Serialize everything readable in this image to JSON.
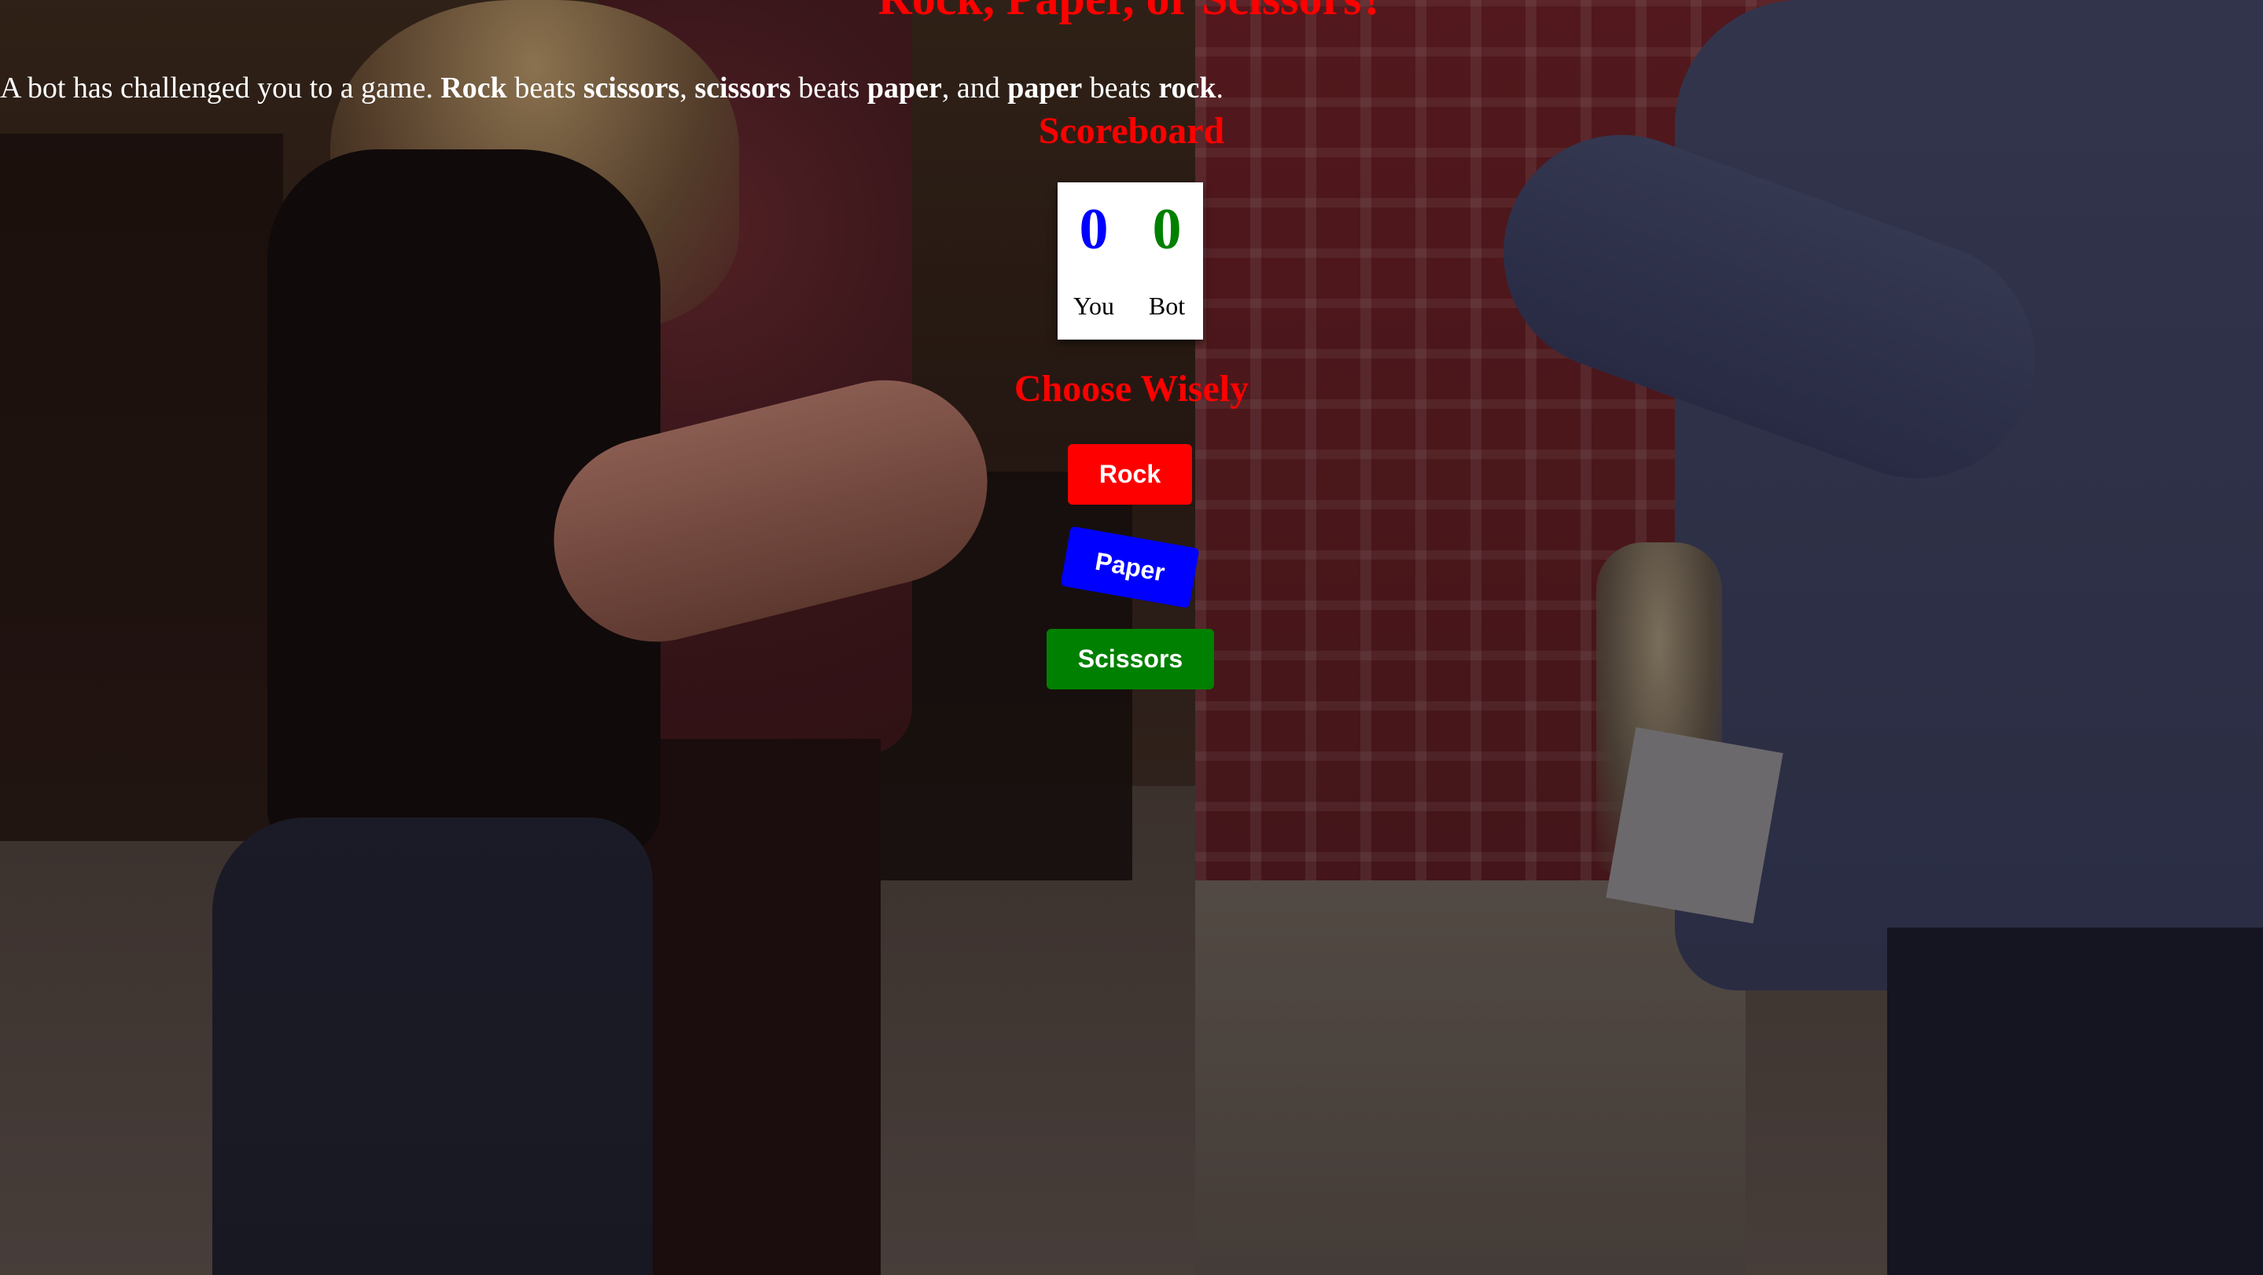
{
  "header": {
    "title": "Rock, Paper, or Scissors?"
  },
  "intro": {
    "p1": "A bot has challenged you to a game. ",
    "rock": "Rock",
    "p2": " beats ",
    "scissors": "scissors",
    "p3": ", ",
    "scissors2": "scissors",
    "p4": " beats ",
    "paper": "paper",
    "p5": ", and ",
    "paper2": "paper",
    "p6": " beats ",
    "rock2": "rock",
    "p7": "."
  },
  "scoreboard": {
    "title": "Scoreboard",
    "you_score": "0",
    "bot_score": "0",
    "you_label": "You",
    "bot_label": "Bot"
  },
  "choices": {
    "title": "Choose Wisely",
    "rock_label": "Rock",
    "paper_label": "Paper",
    "scissors_label": "Scissors"
  },
  "colors": {
    "heading": "#ff0000",
    "you_score": "#0000ff",
    "bot_score": "#008000",
    "rock_button": "#ff0000",
    "paper_button": "#0000ff",
    "scissors_button": "#008000"
  }
}
